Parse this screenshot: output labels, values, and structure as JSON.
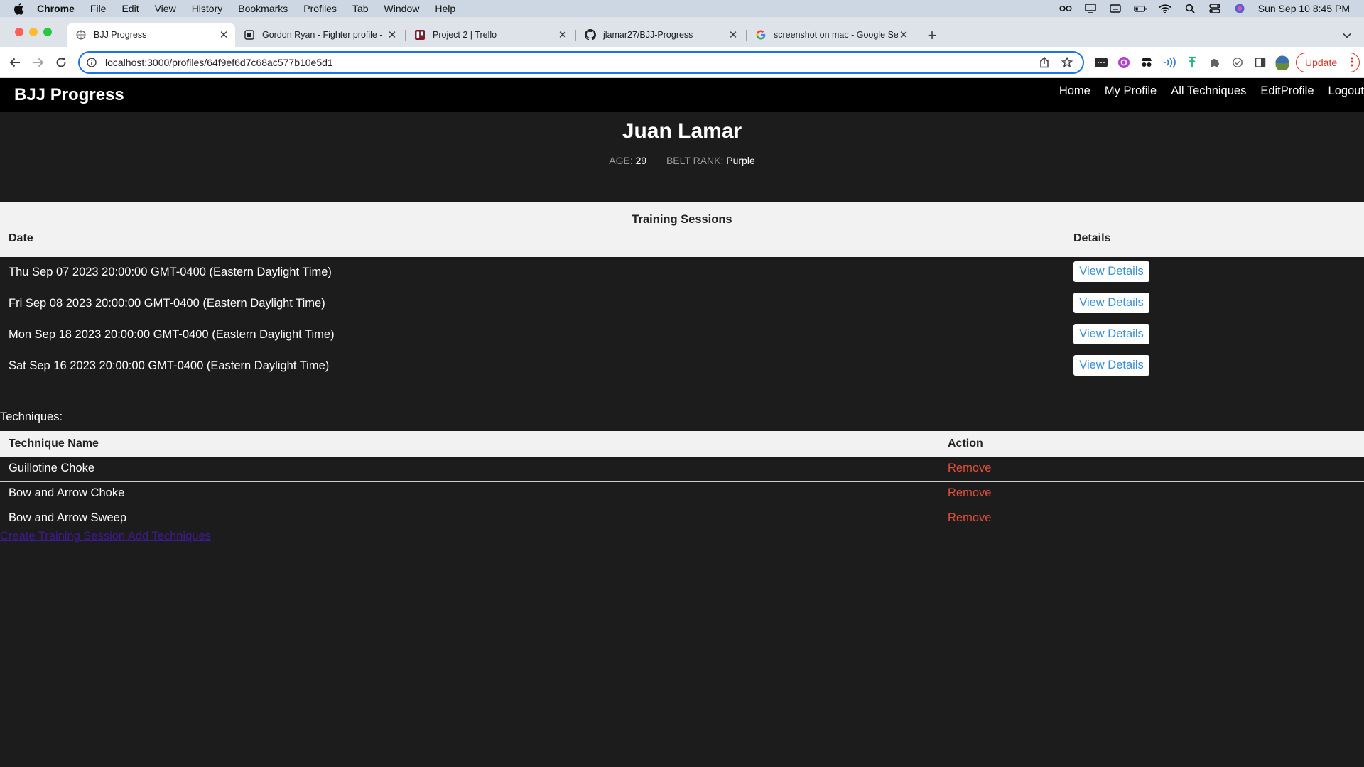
{
  "menubar": {
    "items": [
      "Chrome",
      "File",
      "Edit",
      "View",
      "History",
      "Bookmarks",
      "Profiles",
      "Tab",
      "Window",
      "Help"
    ],
    "clock": "Sun Sep 10  8:45 PM"
  },
  "tabs": [
    {
      "title": "BJJ Progress",
      "active": true
    },
    {
      "title": "Gordon Ryan - Fighter profile -",
      "active": false
    },
    {
      "title": "Project 2 | Trello",
      "active": false
    },
    {
      "title": "jlamar27/BJJ-Progress",
      "active": false
    },
    {
      "title": "screenshot on mac - Google Se",
      "active": false
    }
  ],
  "toolbar": {
    "url": "localhost:3000/profiles/64f9ef6d7c68ac577b10e5d1",
    "update_label": "Update"
  },
  "site": {
    "brand": "BJJ Progress",
    "nav": [
      "Home",
      "My Profile",
      "All Techniques",
      "EditProfile",
      "Logout"
    ]
  },
  "profile": {
    "name": "Juan Lamar",
    "age_label": "AGE:",
    "age": "29",
    "belt_label": "BELT RANK:",
    "belt": "Purple"
  },
  "sessions": {
    "title": "Training Sessions",
    "col_date": "Date",
    "col_details": "Details",
    "button_label": "View Details",
    "rows": [
      "Thu Sep 07 2023 20:00:00 GMT-0400 (Eastern Daylight Time)",
      "Fri Sep 08 2023 20:00:00 GMT-0400 (Eastern Daylight Time)",
      "Mon Sep 18 2023 20:00:00 GMT-0400 (Eastern Daylight Time)",
      "Sat Sep 16 2023 20:00:00 GMT-0400 (Eastern Daylight Time)"
    ]
  },
  "techniques": {
    "label": "Techniques:",
    "col_name": "Technique Name",
    "col_action": "Action",
    "remove_label": "Remove",
    "rows": [
      "Guillotine Choke",
      "Bow and Arrow Choke",
      "Bow and Arrow Sweep"
    ]
  },
  "footer": {
    "create_session": "Create Training Session",
    "add_techniques": "Add Techniques"
  },
  "colors": {
    "page_bg": "#1c1c1c",
    "nav_bg": "#000000",
    "header_row_bg": "#f2f2f2",
    "link_blue": "#3a8fd6",
    "remove_red": "#e0503a",
    "visited_link": "#3d1b8f",
    "omnibox_focus": "#1a73e8"
  }
}
